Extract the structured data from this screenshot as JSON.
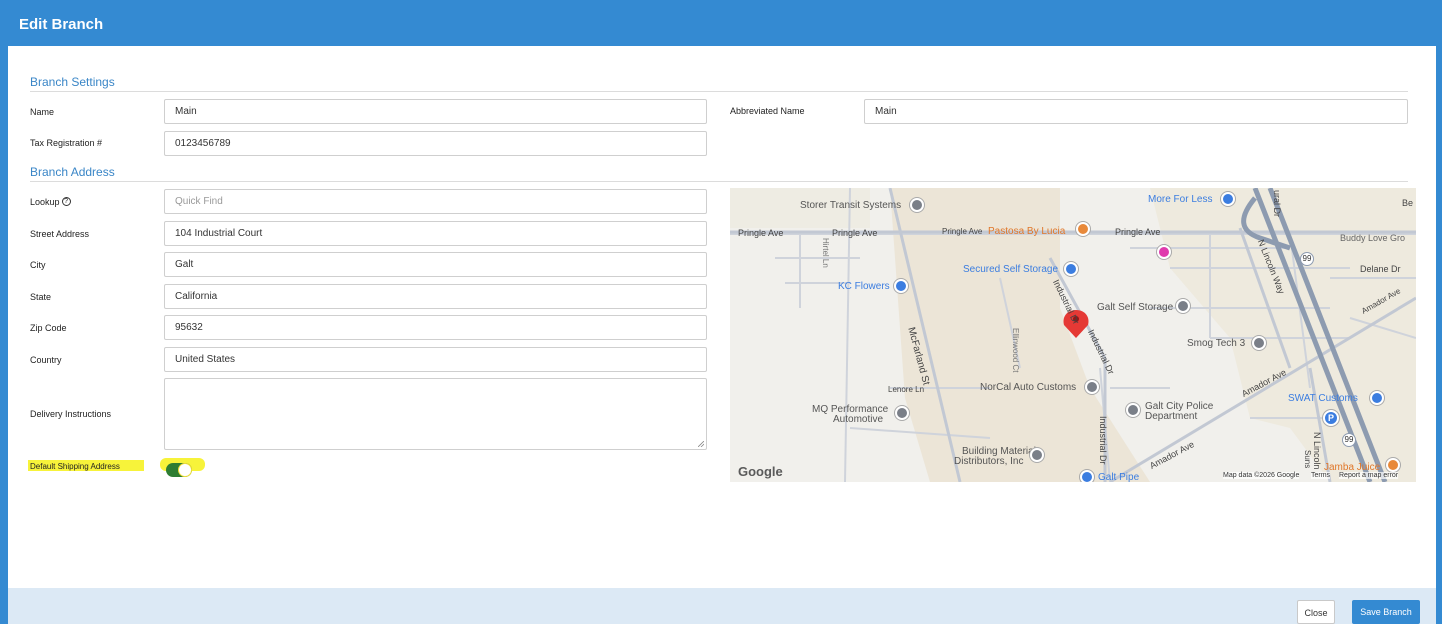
{
  "modal": {
    "title": "Edit Branch"
  },
  "settings": {
    "section_title": "Branch Settings",
    "name_label": "Name",
    "name_value": "Main",
    "abbr_label": "Abbreviated Name",
    "abbr_value": "Main",
    "tax_label": "Tax Registration #",
    "tax_value": "0123456789"
  },
  "address": {
    "section_title": "Branch Address",
    "lookup_label": "Lookup",
    "lookup_placeholder": "Quick Find",
    "street_label": "Street Address",
    "street_value": "104 Industrial Court",
    "city_label": "City",
    "city_value": "Galt",
    "state_label": "State",
    "state_value": "California",
    "zip_label": "Zip Code",
    "zip_value": "95632",
    "country_label": "Country",
    "country_value": "United States",
    "delivery_label": "Delivery Instructions",
    "delivery_value": "",
    "default_label": "Default Shipping Address",
    "default_on": true
  },
  "map": {
    "labels": {
      "storer": "Storer Transit Systems",
      "more_for_less": "More For Less",
      "pringle1": "Pringle Ave",
      "pringle2": "Pringle Ave",
      "pringle3": "Pringle Ave",
      "pringle4": "Pringle Ave",
      "pastosa": "Pastosa By Lucia",
      "buddy_love": "Buddy Love Gro",
      "hirtel": "Hirtel Ln",
      "secured": "Secured Self Storage",
      "lincoln_way": "N Lincoln Way",
      "delane": "Delane Dr",
      "kc_flowers": "KC Flowers",
      "galt_self": "Galt Self Storage",
      "industrial_dr1": "Industrial Dr",
      "industrial_dr2": "Industrial Dr",
      "mcfarland": "McFarland St",
      "ellinwood": "Ellinwood Ct",
      "smog": "Smog Tech 3",
      "amador1": "Amador Ave",
      "amador2": "Amador Ave",
      "amador3": "Amador Ave",
      "norcal": "NorCal Auto Customs",
      "lenore": "Lenore Ln",
      "mq1": "MQ Performance",
      "mq2": "Automotive",
      "police1": "Galt City Police",
      "police2": "Department",
      "swat": "SWAT Customs",
      "industrial_dr3": "Industrial Dr",
      "n_lincoln": "N Lincoln",
      "building1": "Building Material",
      "building2": "Distributors, Inc",
      "galt_pipe": "Galt Pipe",
      "jamba": "Jamba Juice",
      "sunset": "Suns",
      "be": "Be",
      "ural_dr": "ural Dr",
      "shield_99a": "99",
      "shield_99b": "99",
      "parking": "P"
    },
    "logo": "Google",
    "attribution": "Map data ©2026 Google",
    "terms": "Terms",
    "report": "Report a map error"
  },
  "footer": {
    "close_label": "Close",
    "save_label": "Save Branch"
  }
}
